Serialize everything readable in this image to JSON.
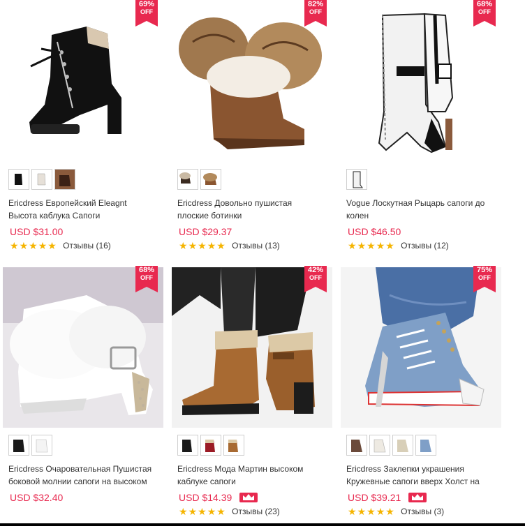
{
  "products": [
    {
      "title": "Ericdress Европейский Eleagnt Высота каблука Сапоги",
      "price": "USD $31.00",
      "discount": "69%",
      "off_label": "OFF",
      "stars": 5,
      "reviews": "Отзывы (16)",
      "thumbs": [
        "black",
        "white",
        "brown"
      ],
      "crown": false,
      "image_desc": "black-lace-up-heel-boot"
    },
    {
      "title": "Ericdress Довольно пушистая плоские ботинки",
      "price": "USD $29.37",
      "discount": "82%",
      "off_label": "OFF",
      "stars": 5,
      "reviews": "Отзывы (13)",
      "thumbs": [
        "black",
        "brown"
      ],
      "crown": false,
      "image_desc": "fur-flat-boot"
    },
    {
      "title": "Vogue Лоскутная Рыцарь сапоги до колен",
      "price": "USD $46.50",
      "discount": "68%",
      "off_label": "OFF",
      "stars": 5,
      "reviews": "Отзывы (12)",
      "thumbs": [
        "white"
      ],
      "crown": false,
      "image_desc": "white-knee-boot"
    },
    {
      "title": "Ericdress Очаровательная Пушистая боковой молнии сапоги на высоком",
      "price": "USD $32.40",
      "discount": "68%",
      "off_label": "OFF",
      "stars": 0,
      "reviews": "",
      "thumbs": [
        "black",
        "white"
      ],
      "crown": false,
      "image_desc": "white-fur-heel-boot"
    },
    {
      "title": "Ericdress Мода Мартин высоком каблуке сапоги",
      "price": "USD $14.39",
      "discount": "42%",
      "off_label": "OFF",
      "stars": 5,
      "reviews": "Отзывы (23)",
      "thumbs": [
        "black",
        "red",
        "brown"
      ],
      "crown": true,
      "image_desc": "brown-martin-boot"
    },
    {
      "title": "Ericdress Заклепки украшения Кружевные сапоги вверх Холст на",
      "price": "USD $39.21",
      "discount": "75%",
      "off_label": "OFF",
      "stars": 5,
      "reviews": "Отзывы (3)",
      "thumbs": [
        "brown",
        "white",
        "beige",
        "denim"
      ],
      "crown": true,
      "image_desc": "denim-heel-sneaker"
    }
  ],
  "colors": {
    "badge": "#e8294f",
    "price": "#e8294f",
    "star": "#f5b400"
  }
}
